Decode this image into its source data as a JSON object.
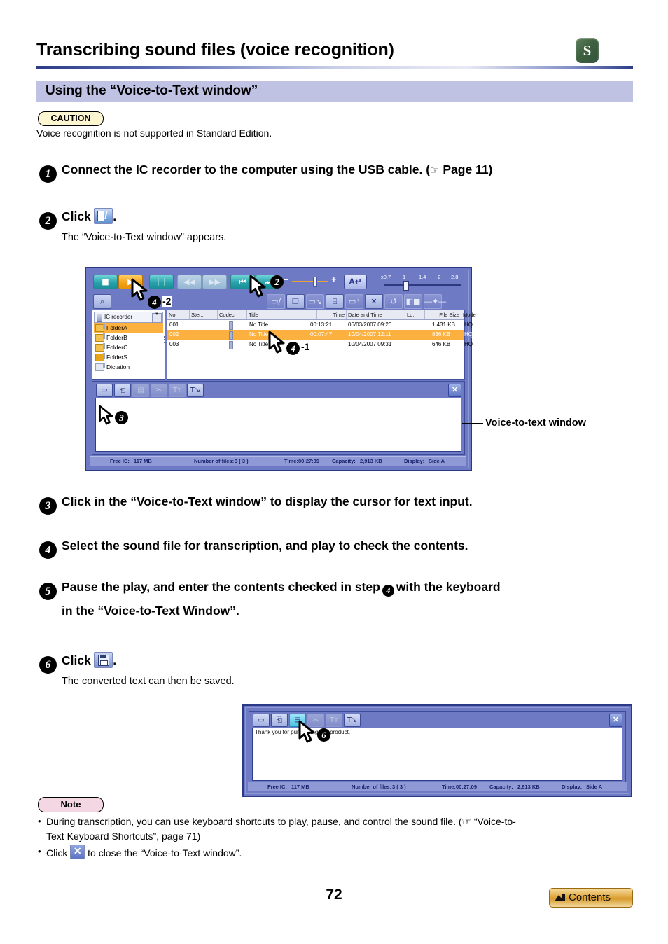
{
  "header": {
    "title": "Transcribing sound files (voice recognition)",
    "badge": "S",
    "section_title": "Using the “Voice-to-Text window”"
  },
  "caution": {
    "label": "CAUTION",
    "text": "Voice recognition is not supported in Standard Edition."
  },
  "steps": {
    "s1_num": "1",
    "s1_text_a": "Connect the IC recorder to the computer using the USB cable. (",
    "s1_hand": "☞",
    "s1_text_b": " Page 11)",
    "s2_num": "2",
    "s2_text": "Click",
    "s2_period": ".",
    "s2_sub": "The “Voice-to-Text window” appears.",
    "s3_num": "3",
    "s3_text": "Click in the “Voice-to-Text window” to display the cursor for text input.",
    "s4_num": "4",
    "s4_text": "Select the sound file for transcription, and play to check the contents.",
    "s5_num": "5",
    "s5_text_a": "Pause the play, and enter the contents checked in step",
    "s5_inline_num": "4",
    "s5_text_b": "with the keyboard",
    "s5_text_c": "in the “Voice-to-Text Window”.",
    "s6_num": "6",
    "s6_text": "Click",
    "s6_period": ".",
    "s6_sub": "The converted text can then be saved."
  },
  "callout": {
    "voice_to_text_window": "Voice-to-text window"
  },
  "annotations": {
    "m2": "2",
    "m3": "3",
    "m4": "4",
    "m4_suffix_1": "-1",
    "m4_suffix_2": "-2",
    "m6": "6"
  },
  "app": {
    "transport": {
      "stop": "■",
      "play": "▶",
      "pause": "❘❘",
      "rew": "◀◀",
      "ffwd": "▶▶",
      "prev": "⏮",
      "next": "⏭",
      "vol_minus": "–",
      "vol_plus": "+",
      "ab_repeat": "A↵"
    },
    "speed": {
      "ticks": [
        "x0.7",
        "1",
        "1.4",
        "2",
        "2.8"
      ]
    },
    "toolbar2": {
      "search": "⌕",
      "items": [
        "▭/",
        "❐",
        "▭↘",
        "⌸",
        "▭⁺",
        "✕",
        "↺",
        "◧■",
        "―✦―"
      ]
    },
    "tree": {
      "device": "IC recorder",
      "folders": [
        "FolderA",
        "FolderB",
        "FolderC",
        "FolderS",
        "Dictation"
      ],
      "selected": "FolderA"
    },
    "list": {
      "columns": [
        "No.",
        "Ster..",
        "Codec",
        "Title",
        "Time",
        "Date and Time",
        "Lo..",
        "File Size",
        "Mode"
      ],
      "rows": [
        {
          "no": "001",
          "title": "No Title",
          "time": "00:13:21",
          "date": "06/03/2007 09:20",
          "size": "1,431 KB",
          "mode": "HQ",
          "selected": false
        },
        {
          "no": "002",
          "title": "No Title",
          "time": "00:07:47",
          "date": "10/04/2007 12:11",
          "size": "836 KB",
          "mode": "HQ",
          "selected": true
        },
        {
          "no": "003",
          "title": "No Title",
          "time": "",
          "date": "10/04/2007 09:31",
          "size": "646 KB",
          "mode": "HQ",
          "selected": false
        }
      ]
    },
    "v2t_toolbar": {
      "new": "▭",
      "open": "⎗",
      "save": "▤",
      "cut": "✂",
      "font": "Tᴛ",
      "insert": "T↘",
      "close": "✕"
    },
    "v2t_text": "",
    "status": {
      "free_label": "Free IC:",
      "free_value": "117 MB",
      "files_label": "Number of files:",
      "files_value": "3 ( 3 )",
      "time_label": "Time:",
      "time_value": "00:27:09",
      "capacity_label": "Capacity:",
      "capacity_value": "2,913 KB",
      "display_label": "Display:",
      "display_value": "Side A"
    }
  },
  "app2": {
    "v2t_text": "Thank you for purchasing this product.",
    "status": {
      "free_label": "Free IC:",
      "free_value": "117 MB",
      "files_label": "Number of files:",
      "files_value": "3 ( 3 )",
      "time_label": "Time:",
      "time_value": "00:27:09",
      "capacity_label": "Capacity:",
      "capacity_value": "2,913 KB",
      "display_label": "Display:",
      "display_value": "Side A"
    }
  },
  "note": {
    "label": "Note",
    "item1_a": "During transcription, you can use keyboard shortcuts to play, pause, and control the sound file. (",
    "item1_hand": "☞",
    "item1_b": " “Voice-to-",
    "item1_c": "Text Keyboard Shortcuts”, page 71)",
    "item2_a": "Click",
    "item2_b": "to close the “Voice-to-Text window”."
  },
  "footer": {
    "page_number": "72",
    "contents_label": "Contents"
  },
  "colors": {
    "accent_band": "#bfc2e3",
    "window_chrome": "#6e7bc4",
    "selection": "#fbb040",
    "rule": "#2c3c88",
    "badge_green": "#3f6140",
    "caution_fill": "#fdf6d0",
    "note_fill": "#f3d8e4",
    "contents_gold": "#e0a83f"
  }
}
